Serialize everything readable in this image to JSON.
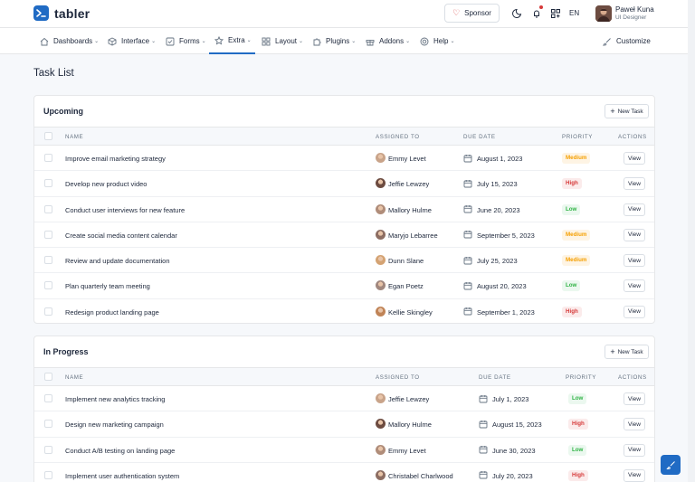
{
  "header": {
    "brand": "tabler",
    "sponsor_label": "Sponsor",
    "language": "EN",
    "user_name": "Paweł Kuna",
    "user_role": "UI Designer"
  },
  "nav": [
    {
      "label": "Dashboards",
      "icon": "home-icon"
    },
    {
      "label": "Interface",
      "icon": "package-icon"
    },
    {
      "label": "Forms",
      "icon": "checkbox-icon"
    },
    {
      "label": "Extra",
      "icon": "star-icon"
    },
    {
      "label": "Layout",
      "icon": "layout-icon"
    },
    {
      "label": "Plugins",
      "icon": "puzzle-icon"
    },
    {
      "label": "Addons",
      "icon": "gift-icon"
    },
    {
      "label": "Help",
      "icon": "lifebuoy-icon"
    }
  ],
  "customize_label": "Customize",
  "page_title": "Task List",
  "new_task_label": "New Task",
  "view_label": "View",
  "upcoming": {
    "title": "Upcoming",
    "headers": [
      "NAME",
      "ASSIGNED TO",
      "DUE DATE",
      "PRIORITY",
      "ACTIONS"
    ],
    "rows": [
      {
        "name": "Improve email marketing strategy",
        "assignee": "Emmy Levet",
        "due": "August 1, 2023",
        "priority": "Medium"
      },
      {
        "name": "Develop new product video",
        "assignee": "Jeffie Lewzey",
        "due": "July 15, 2023",
        "priority": "High"
      },
      {
        "name": "Conduct user interviews for new feature",
        "assignee": "Mallory Hulme",
        "due": "June 20, 2023",
        "priority": "Low"
      },
      {
        "name": "Create social media content calendar",
        "assignee": "Maryjo Lebarree",
        "due": "September 5, 2023",
        "priority": "Medium"
      },
      {
        "name": "Review and update documentation",
        "assignee": "Dunn Slane",
        "due": "July 25, 2023",
        "priority": "Medium"
      },
      {
        "name": "Plan quarterly team meeting",
        "assignee": "Egan Poetz",
        "due": "August 20, 2023",
        "priority": "Low"
      },
      {
        "name": "Redesign product landing page",
        "assignee": "Kellie Skingley",
        "due": "September 1, 2023",
        "priority": "High"
      }
    ]
  },
  "in_progress": {
    "title": "In Progress",
    "headers": [
      "NAME",
      "ASSIGNED TO",
      "DUE DATE",
      "PRIORITY",
      "ACTIONS"
    ],
    "rows": [
      {
        "name": "Implement new analytics tracking",
        "assignee": "Jeffie Lewzey",
        "due": "July 1, 2023",
        "priority": "Low"
      },
      {
        "name": "Design new marketing campaign",
        "assignee": "Mallory Hulme",
        "due": "August 15, 2023",
        "priority": "High"
      },
      {
        "name": "Conduct A/B testing on landing page",
        "assignee": "Emmy Levet",
        "due": "June 30, 2023",
        "priority": "Low"
      },
      {
        "name": "Implement user authentication system",
        "assignee": "Christabel Charlwood",
        "due": "July 20, 2023",
        "priority": "High"
      }
    ]
  },
  "colors": {
    "primary": "#206bc4",
    "danger": "#d63939",
    "warning": "#f59f00",
    "success": "#2fb344"
  }
}
